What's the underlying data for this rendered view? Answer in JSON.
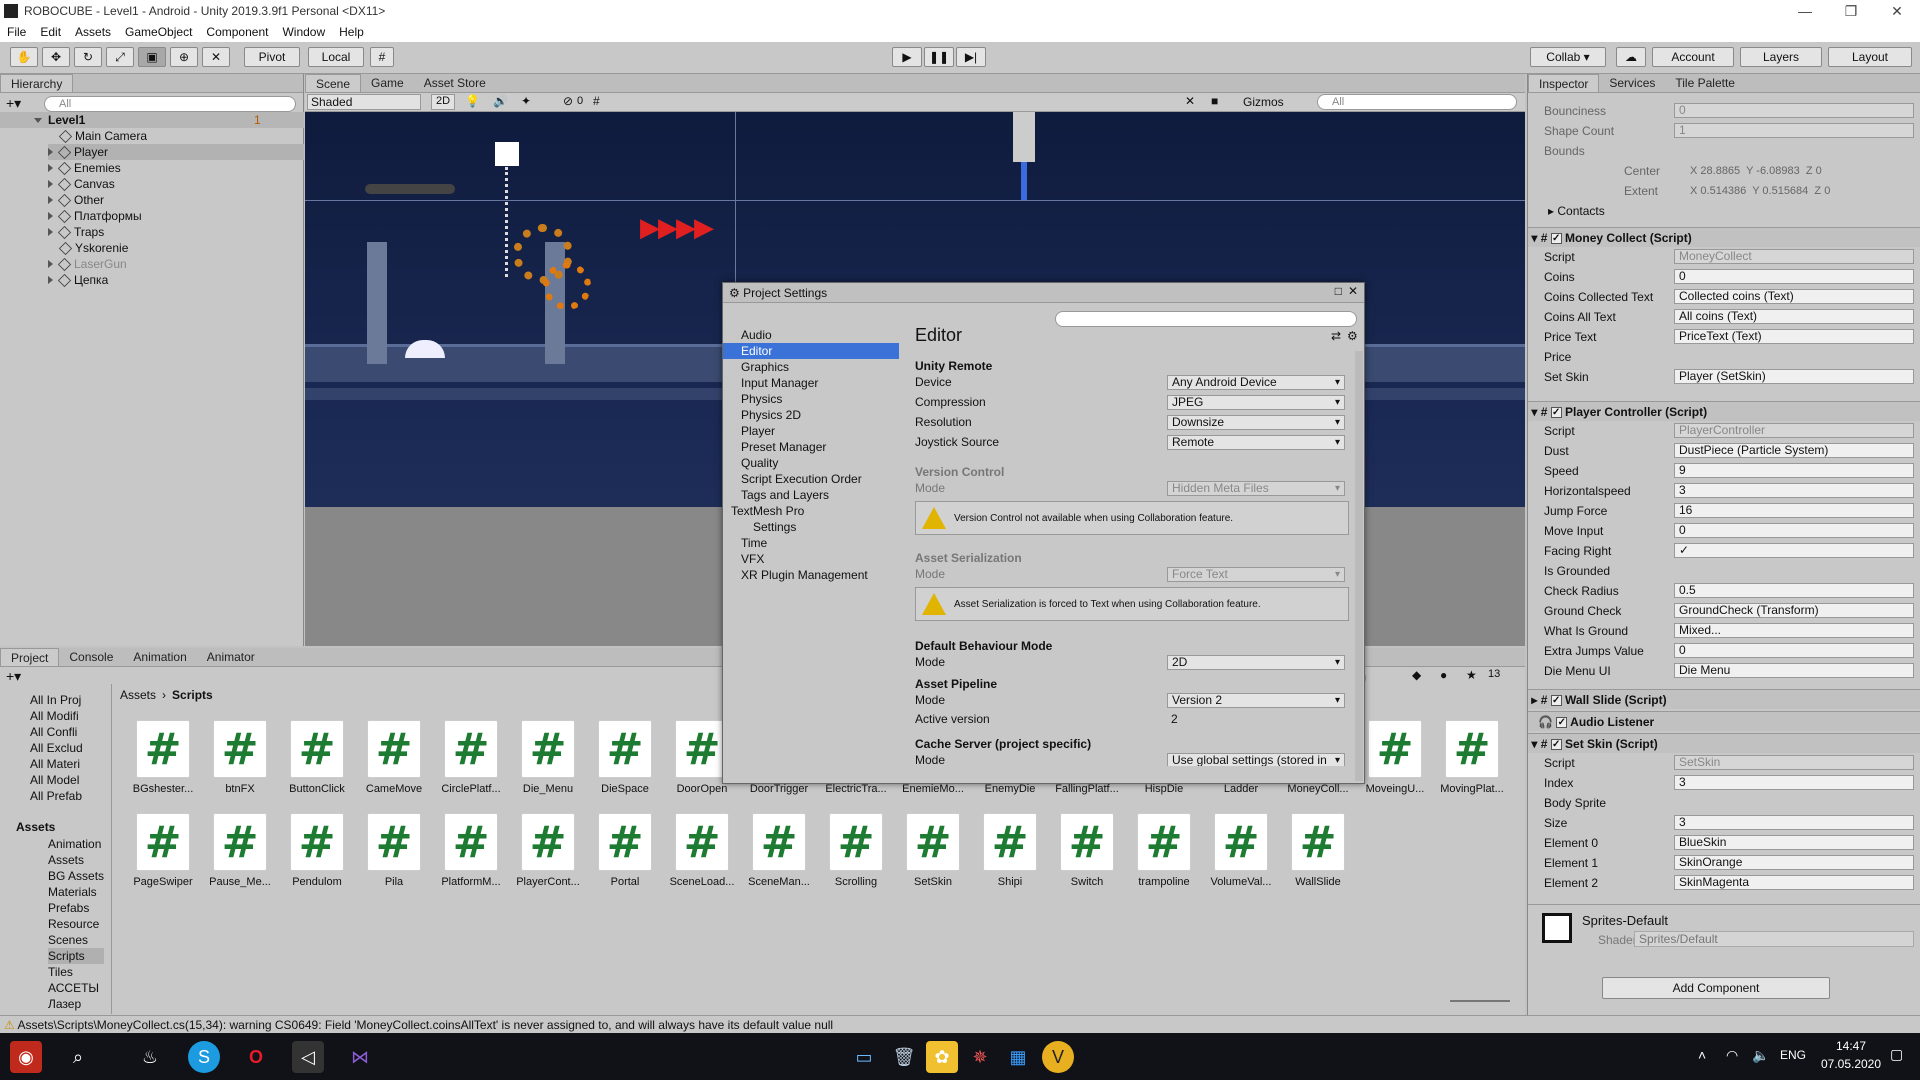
{
  "window": {
    "title": "ROBOCUBE - Level1 - Android - Unity 2019.3.9f1 Personal <DX11>"
  },
  "menu": [
    "File",
    "Edit",
    "Assets",
    "GameObject",
    "Component",
    "Window",
    "Help"
  ],
  "toolbar": {
    "pivot": "Pivot",
    "local": "Local",
    "collab": "Collab ▾",
    "account": "Account",
    "layers": "Layers",
    "layout": "Layout"
  },
  "hierarchy": {
    "tab": "Hierarchy",
    "search": "All",
    "scene": "Level1",
    "badge": "1",
    "items": [
      "Main Camera",
      "Player",
      "Enemies",
      "Canvas",
      "Other",
      "Платформы",
      "Traps",
      "Yskorenie",
      "LaserGun",
      "Цепка"
    ]
  },
  "scene": {
    "tabs": [
      "Scene",
      "Game",
      "Asset Store"
    ],
    "shading": "Shaded",
    "mode2d": "2D",
    "gizmos": "Gizmos",
    "search": "All",
    "count": "0"
  },
  "project": {
    "tabs": [
      "Project",
      "Console",
      "Animation",
      "Animator"
    ],
    "breadcrumb": [
      "Assets",
      "Scripts"
    ],
    "count": "13",
    "favorites": [
      "All In Proj",
      "All Modifi",
      "All Confli",
      "All Exclud",
      "All Materi",
      "All Model",
      "All Prefab"
    ],
    "assets_root": "Assets",
    "folders": [
      "Animation",
      "Assets",
      "BG Assets",
      "Materials",
      "Prefabs",
      "Resource",
      "Scenes",
      "Scripts",
      "Tiles",
      "АССЕТЫ",
      "Лазер"
    ],
    "row1": [
      "BGshester...",
      "btnFX",
      "ButtonClick",
      "CameMove",
      "CirclePlatf...",
      "Die_Menu",
      "DieSpace",
      "DoorOpen",
      "DoorTrigger",
      "ElectricTra...",
      "EnemieMo...",
      "EnemyDie",
      "FallingPlatf...",
      "HispDie",
      "Ladder",
      "MoneyColl...",
      "MoveingU...",
      "MovingPlat..."
    ],
    "row2": [
      "PageSwiper",
      "Pause_Me...",
      "Pendulom",
      "Pila",
      "PlatformM...",
      "PlayerCont...",
      "Portal",
      "SceneLoad...",
      "SceneMan...",
      "Scrolling",
      "SetSkin",
      "Shipi",
      "Switch",
      "trampoline",
      "VolumeVal...",
      "WallSlide"
    ],
    "hash": "#"
  },
  "inspector": {
    "tabs": [
      "Inspector",
      "Services",
      "Tile Palette"
    ],
    "top": [
      {
        "l": "Bounciness",
        "v": "0"
      },
      {
        "l": "Shape Count",
        "v": "1"
      }
    ],
    "bounds": "Bounds",
    "center": {
      "l": "Center",
      "x": "28.8865",
      "y": "-6.08983",
      "z": "0"
    },
    "extent": {
      "l": "Extent",
      "x": "0.514386",
      "y": "0.515684",
      "z": "0"
    },
    "contacts": "Contacts",
    "money": {
      "title": "Money Collect (Script)",
      "rows": [
        {
          "l": "Script",
          "v": "MoneyCollect"
        },
        {
          "l": "Coins",
          "v": "0"
        },
        {
          "l": "Coins Collected Text",
          "v": "Collected coins (Text)"
        },
        {
          "l": "Coins All Text",
          "v": "All coins (Text)"
        },
        {
          "l": "Price Text",
          "v": "PriceText (Text)"
        },
        {
          "l": "Price",
          "v": ""
        },
        {
          "l": "Set Skin",
          "v": "Player (SetSkin)"
        }
      ]
    },
    "player": {
      "title": "Player Controller (Script)",
      "rows": [
        {
          "l": "Script",
          "v": "PlayerController"
        },
        {
          "l": "Dust",
          "v": "DustPiece (Particle System)"
        },
        {
          "l": "Speed",
          "v": "9"
        },
        {
          "l": "Horizontalspeed",
          "v": "3"
        },
        {
          "l": "Jump Force",
          "v": "16"
        },
        {
          "l": "Move Input",
          "v": "0"
        },
        {
          "l": "Facing Right",
          "v": "✓"
        },
        {
          "l": "Is Grounded",
          "v": ""
        },
        {
          "l": "Check Radius",
          "v": "0.5"
        },
        {
          "l": "Ground Check",
          "v": "GroundCheck (Transform)"
        },
        {
          "l": "What Is Ground",
          "v": "Mixed..."
        },
        {
          "l": "Extra Jumps Value",
          "v": "0"
        },
        {
          "l": "Die Menu UI",
          "v": "Die Menu"
        }
      ]
    },
    "wallslide": "Wall Slide (Script)",
    "audio": "Audio Listener",
    "setskin": {
      "title": "Set Skin (Script)",
      "rows": [
        {
          "l": "Script",
          "v": "SetSkin"
        },
        {
          "l": "Index",
          "v": "3"
        },
        {
          "l": "Body Sprite",
          "v": ""
        },
        {
          "l": "Size",
          "v": "3"
        },
        {
          "l": "Element 0",
          "v": "BlueSkin"
        },
        {
          "l": "Element 1",
          "v": "SkinOrange"
        },
        {
          "l": "Element 2",
          "v": "SkinMagenta"
        }
      ]
    },
    "material": "Sprites-Default",
    "shader_label": "Shader",
    "shader": "Sprites/Default",
    "add": "Add Component"
  },
  "dialog": {
    "title": "Project Settings",
    "heading": "Editor",
    "list": [
      "Audio",
      "Editor",
      "Graphics",
      "Input Manager",
      "Physics",
      "Physics 2D",
      "Player",
      "Preset Manager",
      "Quality",
      "Script Execution Order",
      "Tags and Layers",
      "TextMesh Pro",
      "Settings",
      "Time",
      "VFX",
      "XR Plugin Management"
    ],
    "unity_remote": "Unity Remote",
    "device": {
      "l": "Device",
      "v": "Any Android Device"
    },
    "compression": {
      "l": "Compression",
      "v": "JPEG"
    },
    "resolution": {
      "l": "Resolution",
      "v": "Downsize"
    },
    "joystick": {
      "l": "Joystick Source",
      "v": "Remote"
    },
    "version_control": "Version Control",
    "vc_mode": {
      "l": "Mode",
      "v": "Hidden Meta Files"
    },
    "vc_warn": "Version Control not available when using Collaboration feature.",
    "asset_ser": "Asset Serialization",
    "as_mode": {
      "l": "Mode",
      "v": "Force Text"
    },
    "as_warn": "Asset Serialization is forced to Text when using Collaboration feature.",
    "behaviour": "Default Behaviour Mode",
    "bm": {
      "l": "Mode",
      "v": "2D"
    },
    "pipeline": "Asset Pipeline",
    "ap_mode": {
      "l": "Mode",
      "v": "Version 2"
    },
    "active": {
      "l": "Active version",
      "v": "2"
    },
    "cache": "Cache Server (project specific)",
    "cs_mode": {
      "l": "Mode",
      "v": "Use global settings (stored in"
    }
  },
  "status": "Assets\\Scripts\\MoneyCollect.cs(15,34): warning CS0649: Field 'MoneyCollect.coinsAllText' is never assigned to, and will always have its default value null",
  "taskbar": {
    "lang": "ENG",
    "time": "14:47",
    "date": "07.05.2020"
  }
}
